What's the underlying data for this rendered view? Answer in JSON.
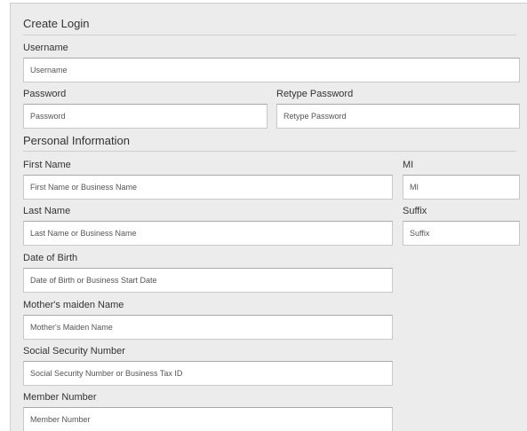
{
  "create_login": {
    "title": "Create Login",
    "username": {
      "label": "Username",
      "placeholder": "Username",
      "value": ""
    },
    "password": {
      "label": "Password",
      "placeholder": "Password",
      "value": ""
    },
    "retype_password": {
      "label": "Retype Password",
      "placeholder": "Retype Password",
      "value": ""
    }
  },
  "personal_information": {
    "title": "Personal Information",
    "first_name": {
      "label": "First Name",
      "placeholder": "First Name or Business Name",
      "value": ""
    },
    "mi": {
      "label": "MI",
      "placeholder": "MI",
      "value": ""
    },
    "last_name": {
      "label": "Last Name",
      "placeholder": "Last Name or Business Name",
      "value": ""
    },
    "suffix": {
      "label": "Suffix",
      "placeholder": "Suffix",
      "value": ""
    },
    "date_of_birth": {
      "label": "Date of Birth",
      "placeholder": "Date of Birth or Business Start Date",
      "value": ""
    },
    "mothers_maiden_name": {
      "label": "Mother's maiden Name",
      "placeholder": "Mother's Maiden Name",
      "value": ""
    },
    "ssn": {
      "label": "Social Security Number",
      "placeholder": "Social Security Number or Business Tax ID",
      "value": ""
    },
    "member_number": {
      "label": "Member Number",
      "placeholder": "Member Number",
      "value": ""
    }
  }
}
